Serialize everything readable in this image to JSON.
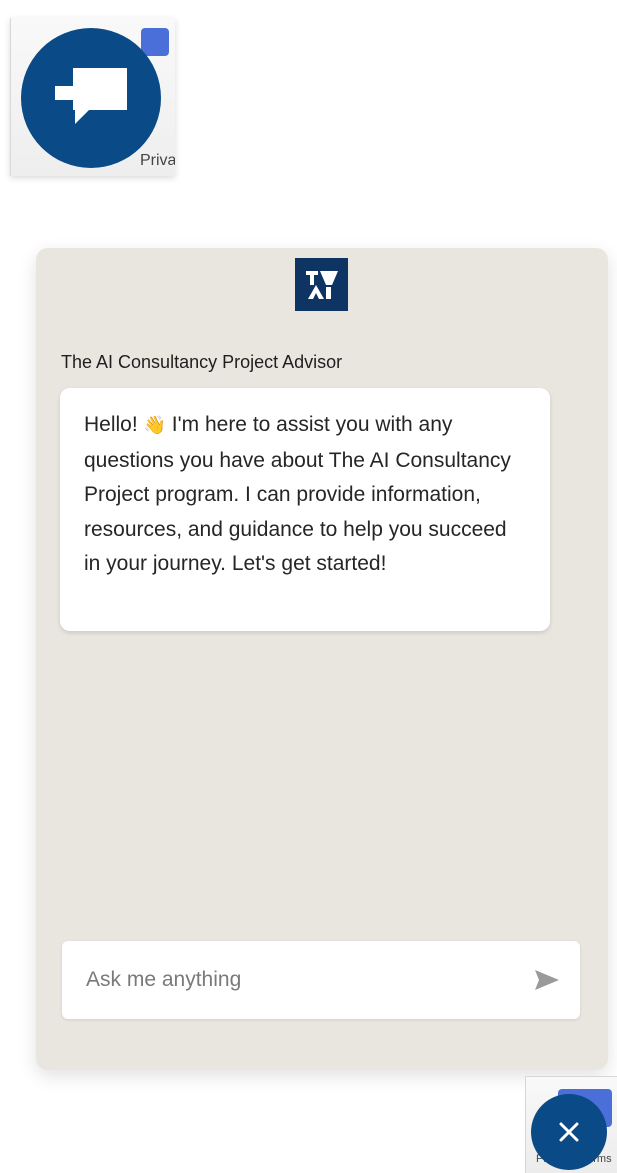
{
  "top_widget": {
    "recaptcha_text": "Privacy - Terms",
    "launcher_icon": "chat-bubble-icon"
  },
  "chat": {
    "logo_icon": "advisor-logo-icon",
    "advisor_name": "The AI Consultancy Project Advisor",
    "message": {
      "before_emoji": "Hello! ",
      "emoji": "👋",
      "after_emoji": " I'm here to assist you with any questions you have about The AI Consultancy Project program. I can provide information, resources, and guidance to help you succeed in your journey. Let's get started!"
    },
    "input_placeholder": "Ask me anything",
    "send_icon": "send-icon"
  },
  "bottom_widget": {
    "recaptcha_text": "Privacy - Terms",
    "close_icon": "close-icon"
  },
  "colors": {
    "brand_blue": "#0a4a86",
    "logo_navy": "#0d3462",
    "panel_bg": "#e9e6df"
  }
}
